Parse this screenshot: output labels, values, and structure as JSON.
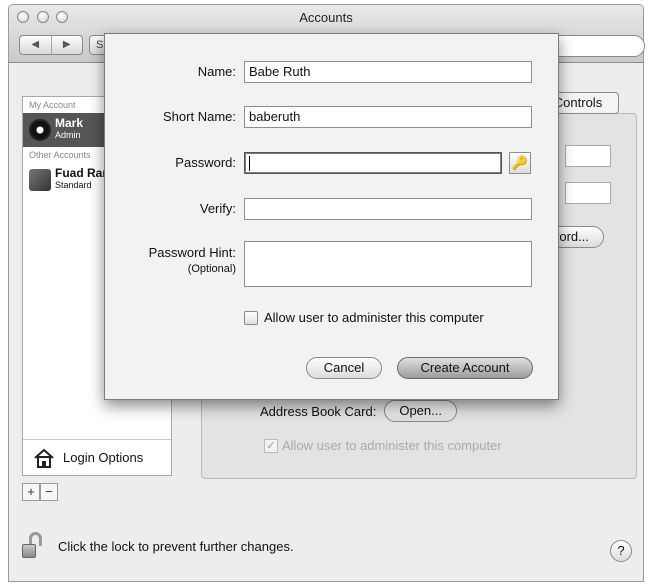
{
  "window": {
    "title": "Accounts"
  },
  "toolbar": {
    "back": "◀",
    "forward": "▶",
    "show_all": "Show All"
  },
  "sidebar": {
    "my_account_header": "My Account",
    "my_account": {
      "name": "Mark",
      "type": "Admin"
    },
    "other_header": "Other Accounts",
    "other_account": {
      "name": "Fuad Ramses",
      "type": "Standard"
    },
    "login_options": "Login Options",
    "add": "+",
    "remove": "−"
  },
  "panel": {
    "parental_controls_tab": "Controls",
    "reset_password_button": "Change Password...",
    "address_book_label": "Address Book Card:",
    "open_button": "Open...",
    "allow_admin_label": "Allow user to administer this computer",
    "allow_admin_checked": true
  },
  "sheet": {
    "name_label": "Name:",
    "name_value": "Babe Ruth",
    "short_name_label": "Short Name:",
    "short_name_value": "baberuth",
    "password_label": "Password:",
    "password_value": "",
    "key_icon": "🔑",
    "verify_label": "Verify:",
    "verify_value": "",
    "hint_label": "Password Hint:",
    "hint_optional": "(Optional)",
    "hint_value": "",
    "allow_admin_label": "Allow user to administer this computer",
    "allow_admin_checked": false,
    "cancel_button": "Cancel",
    "create_button": "Create Account"
  },
  "footer": {
    "lock_text": "Click the lock to prevent further changes.",
    "help": "?"
  }
}
